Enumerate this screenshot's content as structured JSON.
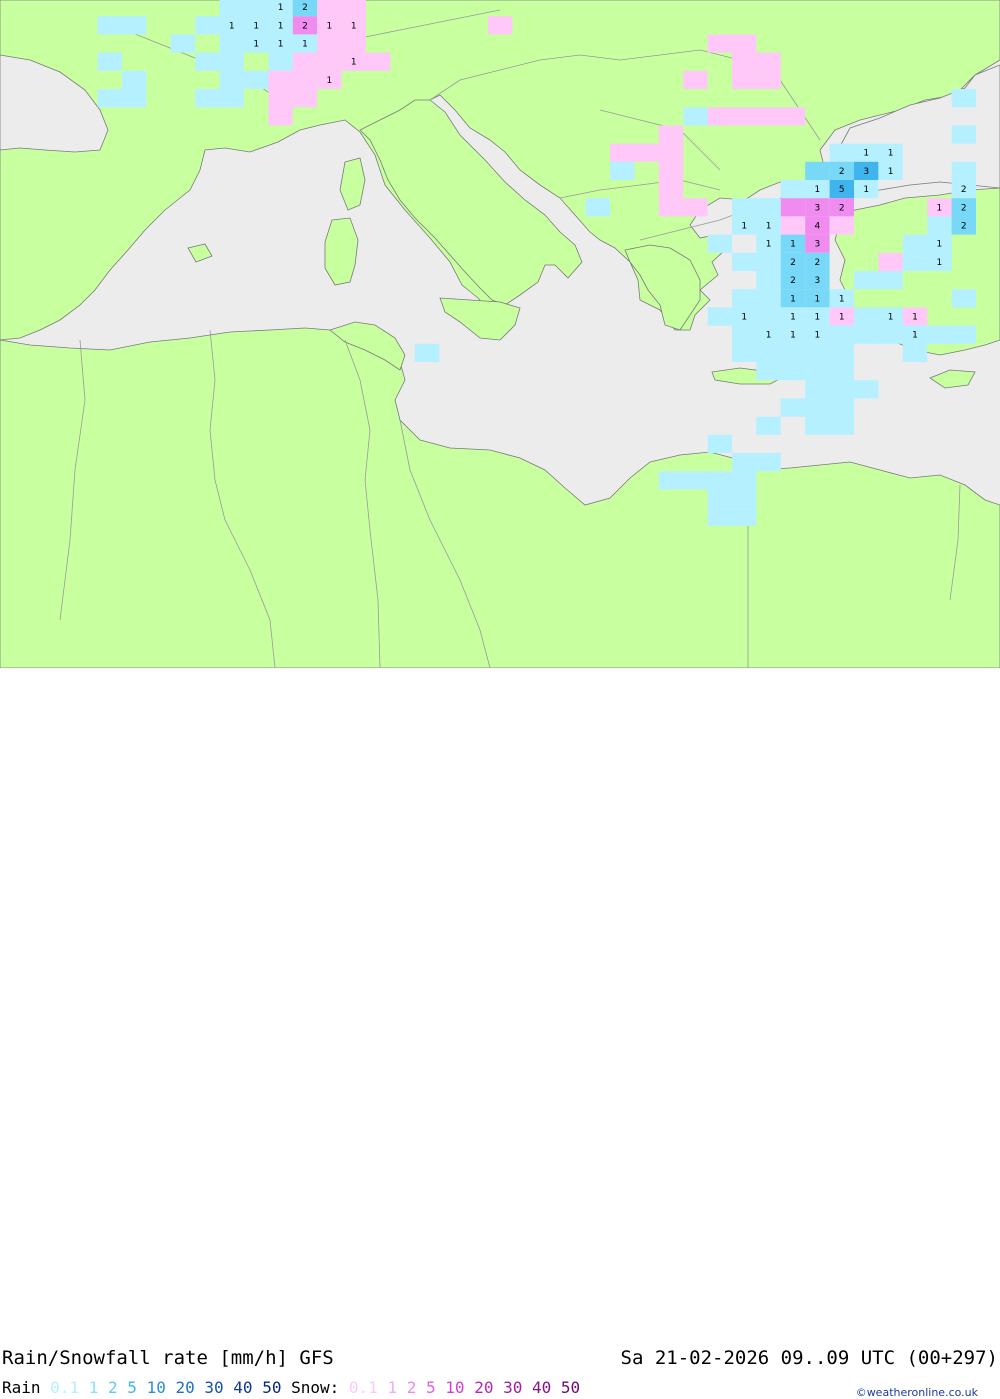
{
  "map": {
    "colors": {
      "sea": "#ececec",
      "land": "#c8ff9f",
      "border": "#9a9a9a",
      "coast": "#7a7a7a",
      "rain_light": "#b4f0ff",
      "rain_mid": "#78d8f8",
      "rain_heavy": "#40b4ec",
      "snow_light": "#ffc8f8",
      "snow_mid": "#f08cf0"
    },
    "cells": [
      {
        "c": 9,
        "r": 0,
        "t": "r1"
      },
      {
        "c": 10,
        "r": 0,
        "t": "r1"
      },
      {
        "c": 11,
        "r": 0,
        "t": "r1",
        "v": "1"
      },
      {
        "c": 12,
        "r": 0,
        "t": "r2",
        "v": "2"
      },
      {
        "c": 13,
        "r": 0,
        "t": "s1"
      },
      {
        "c": 14,
        "r": 0,
        "t": "s1"
      },
      {
        "c": 8,
        "r": 1,
        "t": "r1"
      },
      {
        "c": 9,
        "r": 1,
        "t": "r1",
        "v": "1"
      },
      {
        "c": 10,
        "r": 1,
        "t": "r1",
        "v": "1"
      },
      {
        "c": 11,
        "r": 1,
        "t": "r1",
        "v": "1"
      },
      {
        "c": 12,
        "r": 1,
        "t": "s2",
        "v": "2"
      },
      {
        "c": 13,
        "r": 1,
        "t": "s1",
        "v": "1"
      },
      {
        "c": 14,
        "r": 1,
        "t": "s1",
        "v": "1"
      },
      {
        "c": 4,
        "r": 1,
        "t": "r1"
      },
      {
        "c": 5,
        "r": 1,
        "t": "r1"
      },
      {
        "c": 20,
        "r": 1,
        "t": "s1"
      },
      {
        "c": 9,
        "r": 2,
        "t": "r1"
      },
      {
        "c": 10,
        "r": 2,
        "t": "r1",
        "v": "1"
      },
      {
        "c": 11,
        "r": 2,
        "t": "r1",
        "v": "1"
      },
      {
        "c": 12,
        "r": 2,
        "t": "r1",
        "v": "1"
      },
      {
        "c": 13,
        "r": 2,
        "t": "s1"
      },
      {
        "c": 14,
        "r": 2,
        "t": "s1"
      },
      {
        "c": 7,
        "r": 2,
        "t": "r1"
      },
      {
        "c": 29,
        "r": 2,
        "t": "s1"
      },
      {
        "c": 30,
        "r": 2,
        "t": "s1"
      },
      {
        "c": 8,
        "r": 3,
        "t": "r1"
      },
      {
        "c": 9,
        "r": 3,
        "t": "r1"
      },
      {
        "c": 11,
        "r": 3,
        "t": "r1"
      },
      {
        "c": 12,
        "r": 3,
        "t": "s1"
      },
      {
        "c": 13,
        "r": 3,
        "t": "s1"
      },
      {
        "c": 14,
        "r": 3,
        "t": "s1",
        "v": "1"
      },
      {
        "c": 15,
        "r": 3,
        "t": "s1"
      },
      {
        "c": 4,
        "r": 3,
        "t": "r1"
      },
      {
        "c": 30,
        "r": 3,
        "t": "s1"
      },
      {
        "c": 31,
        "r": 3,
        "t": "s1"
      },
      {
        "c": 9,
        "r": 4,
        "t": "r1"
      },
      {
        "c": 10,
        "r": 4,
        "t": "r1"
      },
      {
        "c": 11,
        "r": 4,
        "t": "s1"
      },
      {
        "c": 12,
        "r": 4,
        "t": "s1"
      },
      {
        "c": 13,
        "r": 4,
        "t": "s1",
        "v": "1"
      },
      {
        "c": 5,
        "r": 4,
        "t": "r1"
      },
      {
        "c": 28,
        "r": 4,
        "t": "s1"
      },
      {
        "c": 30,
        "r": 4,
        "t": "s1"
      },
      {
        "c": 31,
        "r": 4,
        "t": "s1"
      },
      {
        "c": 8,
        "r": 5,
        "t": "r1"
      },
      {
        "c": 9,
        "r": 5,
        "t": "r1"
      },
      {
        "c": 11,
        "r": 5,
        "t": "s1"
      },
      {
        "c": 12,
        "r": 5,
        "t": "s1"
      },
      {
        "c": 4,
        "r": 5,
        "t": "r1"
      },
      {
        "c": 5,
        "r": 5,
        "t": "r1"
      },
      {
        "c": 39,
        "r": 5,
        "t": "r1"
      },
      {
        "c": 29,
        "r": 6,
        "t": "s1"
      },
      {
        "c": 30,
        "r": 6,
        "t": "s1"
      },
      {
        "c": 31,
        "r": 6,
        "t": "s1"
      },
      {
        "c": 32,
        "r": 6,
        "t": "s1"
      },
      {
        "c": 28,
        "r": 6,
        "t": "r1"
      },
      {
        "c": 11,
        "r": 6,
        "t": "s1"
      },
      {
        "c": 27,
        "r": 7,
        "t": "s1"
      },
      {
        "c": 39,
        "r": 7,
        "t": "r1"
      },
      {
        "c": 26,
        "r": 8,
        "t": "s1"
      },
      {
        "c": 27,
        "r": 8,
        "t": "s1"
      },
      {
        "c": 27,
        "r": 9,
        "t": "s1"
      },
      {
        "c": 27,
        "r": 10,
        "t": "s1"
      },
      {
        "c": 25,
        "r": 8,
        "t": "s1"
      },
      {
        "c": 25,
        "r": 9,
        "t": "s1"
      },
      {
        "c": 27,
        "r": 11,
        "t": "s1"
      },
      {
        "c": 28,
        "r": 11,
        "t": "s1"
      },
      {
        "c": 34,
        "r": 8,
        "t": "r1"
      },
      {
        "c": 35,
        "r": 8,
        "t": "r1",
        "v": "1"
      },
      {
        "c": 36,
        "r": 8,
        "t": "r1",
        "v": "1"
      },
      {
        "c": 33,
        "r": 9,
        "t": "r2"
      },
      {
        "c": 34,
        "r": 9,
        "t": "r2",
        "v": "2"
      },
      {
        "c": 35,
        "r": 9,
        "t": "r3",
        "v": "3"
      },
      {
        "c": 36,
        "r": 9,
        "t": "r1",
        "v": "1"
      },
      {
        "c": 39,
        "r": 9,
        "t": "r1"
      },
      {
        "c": 25,
        "r": 9,
        "t": "r1"
      },
      {
        "c": 32,
        "r": 10,
        "t": "r1"
      },
      {
        "c": 33,
        "r": 10,
        "t": "r1",
        "v": "1"
      },
      {
        "c": 34,
        "r": 10,
        "t": "r3",
        "v": "5"
      },
      {
        "c": 35,
        "r": 10,
        "t": "r1",
        "v": "1"
      },
      {
        "c": 39,
        "r": 10,
        "t": "r1",
        "v": "2"
      },
      {
        "c": 30,
        "r": 11,
        "t": "r1"
      },
      {
        "c": 31,
        "r": 11,
        "t": "r1"
      },
      {
        "c": 32,
        "r": 11,
        "t": "s2"
      },
      {
        "c": 33,
        "r": 11,
        "t": "s2",
        "v": "3"
      },
      {
        "c": 34,
        "r": 11,
        "t": "s2",
        "v": "2"
      },
      {
        "c": 38,
        "r": 11,
        "t": "s1",
        "v": "1"
      },
      {
        "c": 39,
        "r": 11,
        "t": "r2",
        "v": "2"
      },
      {
        "c": 24,
        "r": 11,
        "t": "r1"
      },
      {
        "c": 30,
        "r": 12,
        "t": "r1",
        "v": "1"
      },
      {
        "c": 31,
        "r": 12,
        "t": "r1",
        "v": "1"
      },
      {
        "c": 32,
        "r": 12,
        "t": "s1"
      },
      {
        "c": 33,
        "r": 12,
        "t": "s2",
        "v": "4"
      },
      {
        "c": 34,
        "r": 12,
        "t": "s1"
      },
      {
        "c": 38,
        "r": 12,
        "t": "r1"
      },
      {
        "c": 39,
        "r": 12,
        "t": "r2",
        "v": "2"
      },
      {
        "c": 29,
        "r": 13,
        "t": "r1"
      },
      {
        "c": 31,
        "r": 13,
        "t": "r1",
        "v": "1"
      },
      {
        "c": 32,
        "r": 13,
        "t": "r2",
        "v": "1"
      },
      {
        "c": 33,
        "r": 13,
        "t": "s2",
        "v": "3"
      },
      {
        "c": 37,
        "r": 13,
        "t": "r1"
      },
      {
        "c": 38,
        "r": 13,
        "t": "r1",
        "v": "1"
      },
      {
        "c": 30,
        "r": 14,
        "t": "r1"
      },
      {
        "c": 31,
        "r": 14,
        "t": "r1"
      },
      {
        "c": 32,
        "r": 14,
        "t": "r2",
        "v": "2"
      },
      {
        "c": 33,
        "r": 14,
        "t": "r2",
        "v": "2"
      },
      {
        "c": 36,
        "r": 14,
        "t": "s1"
      },
      {
        "c": 37,
        "r": 14,
        "t": "r1"
      },
      {
        "c": 38,
        "r": 14,
        "t": "r1",
        "v": "1"
      },
      {
        "c": 31,
        "r": 15,
        "t": "r1"
      },
      {
        "c": 32,
        "r": 15,
        "t": "r2",
        "v": "2"
      },
      {
        "c": 33,
        "r": 15,
        "t": "r2",
        "v": "3"
      },
      {
        "c": 35,
        "r": 15,
        "t": "r1"
      },
      {
        "c": 36,
        "r": 15,
        "t": "r1"
      },
      {
        "c": 30,
        "r": 16,
        "t": "r1"
      },
      {
        "c": 31,
        "r": 16,
        "t": "r1"
      },
      {
        "c": 32,
        "r": 16,
        "t": "r2",
        "v": "1"
      },
      {
        "c": 33,
        "r": 16,
        "t": "r2",
        "v": "1"
      },
      {
        "c": 34,
        "r": 16,
        "t": "r1",
        "v": "1"
      },
      {
        "c": 39,
        "r": 16,
        "t": "r1"
      },
      {
        "c": 29,
        "r": 17,
        "t": "r1"
      },
      {
        "c": 30,
        "r": 17,
        "t": "r1",
        "v": "1"
      },
      {
        "c": 31,
        "r": 17,
        "t": "r1"
      },
      {
        "c": 32,
        "r": 17,
        "t": "r1",
        "v": "1"
      },
      {
        "c": 33,
        "r": 17,
        "t": "r1",
        "v": "1"
      },
      {
        "c": 34,
        "r": 17,
        "t": "s1",
        "v": "1"
      },
      {
        "c": 35,
        "r": 17,
        "t": "r1"
      },
      {
        "c": 36,
        "r": 17,
        "t": "r1",
        "v": "1"
      },
      {
        "c": 37,
        "r": 17,
        "t": "s1",
        "v": "1"
      },
      {
        "c": 30,
        "r": 18,
        "t": "r1"
      },
      {
        "c": 31,
        "r": 18,
        "t": "r1",
        "v": "1"
      },
      {
        "c": 32,
        "r": 18,
        "t": "r1",
        "v": "1"
      },
      {
        "c": 33,
        "r": 18,
        "t": "r1",
        "v": "1"
      },
      {
        "c": 34,
        "r": 18,
        "t": "r1"
      },
      {
        "c": 35,
        "r": 18,
        "t": "r1"
      },
      {
        "c": 36,
        "r": 18,
        "t": "r1"
      },
      {
        "c": 37,
        "r": 18,
        "t": "r1",
        "v": "1"
      },
      {
        "c": 38,
        "r": 18,
        "t": "r1"
      },
      {
        "c": 39,
        "r": 18,
        "t": "r1"
      },
      {
        "c": 30,
        "r": 19,
        "t": "r1"
      },
      {
        "c": 31,
        "r": 19,
        "t": "r1"
      },
      {
        "c": 32,
        "r": 19,
        "t": "r1"
      },
      {
        "c": 33,
        "r": 19,
        "t": "r1"
      },
      {
        "c": 34,
        "r": 19,
        "t": "r1"
      },
      {
        "c": 17,
        "r": 19,
        "t": "r1"
      },
      {
        "c": 37,
        "r": 19,
        "t": "r1"
      },
      {
        "c": 31,
        "r": 20,
        "t": "r1"
      },
      {
        "c": 32,
        "r": 20,
        "t": "r1"
      },
      {
        "c": 33,
        "r": 20,
        "t": "r1"
      },
      {
        "c": 34,
        "r": 20,
        "t": "r1"
      },
      {
        "c": 34,
        "r": 21,
        "t": "r1"
      },
      {
        "c": 35,
        "r": 21,
        "t": "r1"
      },
      {
        "c": 33,
        "r": 21,
        "t": "r1"
      },
      {
        "c": 32,
        "r": 22,
        "t": "r1"
      },
      {
        "c": 33,
        "r": 22,
        "t": "r1"
      },
      {
        "c": 34,
        "r": 22,
        "t": "r1"
      },
      {
        "c": 33,
        "r": 23,
        "t": "r1"
      },
      {
        "c": 34,
        "r": 23,
        "t": "r1"
      },
      {
        "c": 31,
        "r": 23,
        "t": "r1"
      },
      {
        "c": 29,
        "r": 24,
        "t": "r1"
      },
      {
        "c": 30,
        "r": 25,
        "t": "r1"
      },
      {
        "c": 31,
        "r": 25,
        "t": "r1"
      },
      {
        "c": 27,
        "r": 26,
        "t": "r1"
      },
      {
        "c": 28,
        "r": 26,
        "t": "r1"
      },
      {
        "c": 29,
        "r": 26,
        "t": "r1"
      },
      {
        "c": 30,
        "r": 26,
        "t": "r1"
      },
      {
        "c": 29,
        "r": 27,
        "t": "r1"
      },
      {
        "c": 30,
        "r": 27,
        "t": "r1"
      },
      {
        "c": 29,
        "r": 28,
        "t": "r1"
      },
      {
        "c": 30,
        "r": 28,
        "t": "r1"
      }
    ]
  },
  "footer": {
    "title": "Rain/Snowfall rate [mm/h] GFS",
    "datetime": "Sa 21-02-2026 09..09 UTC (00+297)",
    "rain_label": "Rain",
    "rain_levels": [
      {
        "t": "0.1",
        "color": "#b4f0ff"
      },
      {
        "t": "1",
        "color": "#8ce0ff"
      },
      {
        "t": "2",
        "color": "#64c8f4"
      },
      {
        "t": "5",
        "color": "#40b4ec"
      },
      {
        "t": "10",
        "color": "#2c8cd8"
      },
      {
        "t": "20",
        "color": "#2070c8"
      },
      {
        "t": "30",
        "color": "#1850b0"
      },
      {
        "t": "40",
        "color": "#103898"
      },
      {
        "t": "50",
        "color": "#082880"
      }
    ],
    "snow_label": "Snow:",
    "snow_levels": [
      {
        "t": "0.1",
        "color": "#ffc8f8"
      },
      {
        "t": "1",
        "color": "#f8a8f0"
      },
      {
        "t": "2",
        "color": "#f088e8"
      },
      {
        "t": "5",
        "color": "#e060e0"
      },
      {
        "t": "10",
        "color": "#d040d0"
      },
      {
        "t": "20",
        "color": "#b828b8"
      },
      {
        "t": "30",
        "color": "#a01ca0"
      },
      {
        "t": "40",
        "color": "#881088"
      },
      {
        "t": "50",
        "color": "#700870"
      }
    ],
    "credit": "©weatheronline.co.uk"
  }
}
